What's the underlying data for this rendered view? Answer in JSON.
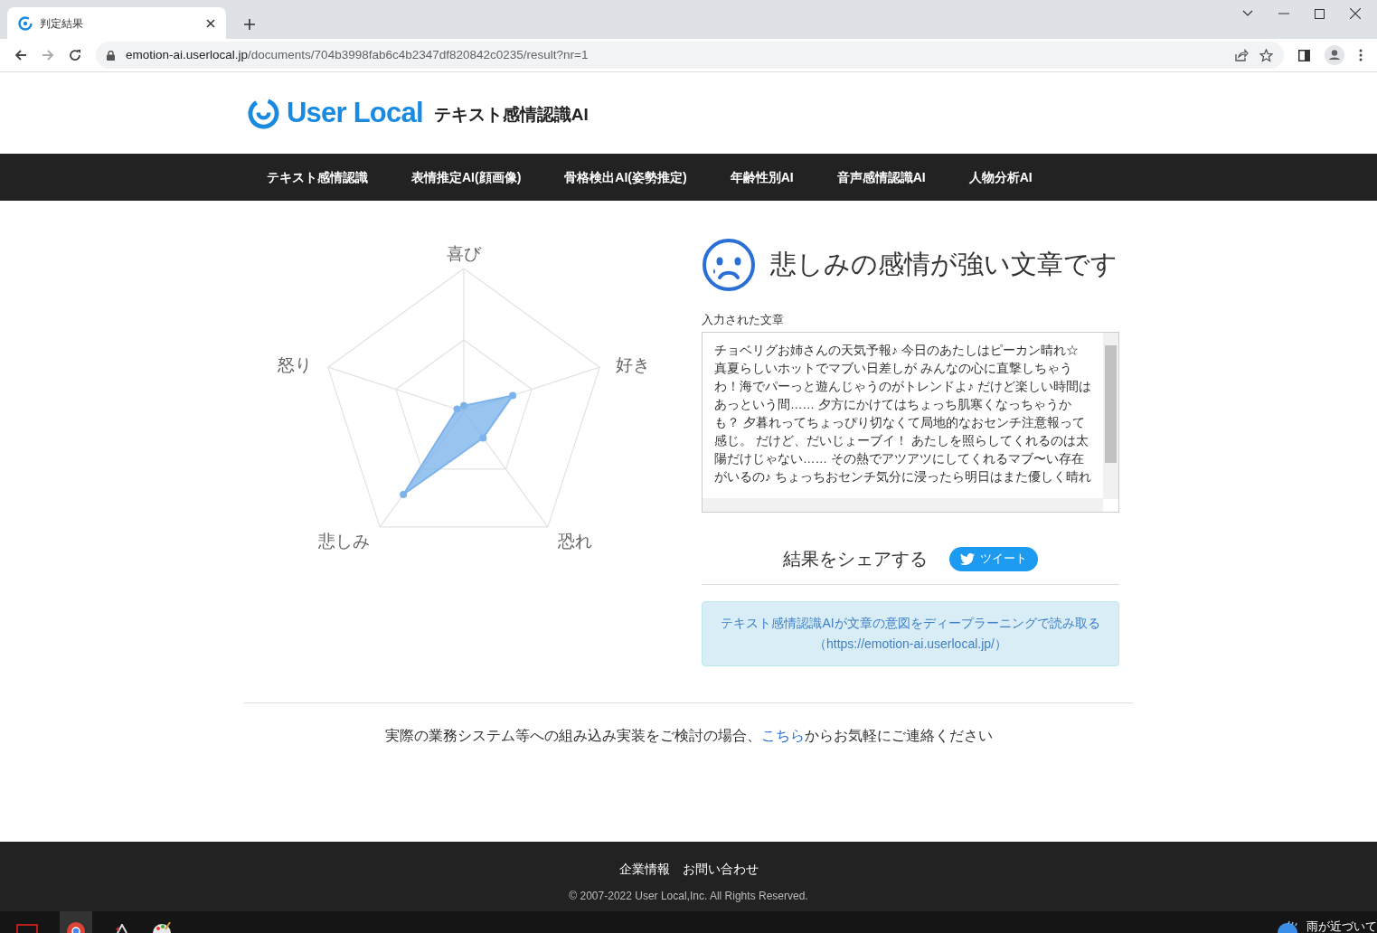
{
  "browser": {
    "tab_title": "判定結果",
    "url_host": "emotion-ai.userlocal.jp",
    "url_path": "/documents/704b3998fab6c4b2347df820842c0235/result?nr=1"
  },
  "header": {
    "logo": "User Local",
    "product": "テキスト感情認識AI"
  },
  "nav": [
    "テキスト感情認識",
    "表情推定AI(顔画像)",
    "骨格検出AI(姿勢推定)",
    "年齢性別AI",
    "音声感情認識AI",
    "人物分析AI"
  ],
  "radar": {
    "axes": [
      "喜び",
      "好き",
      "恐れ",
      "悲しみ",
      "怒り"
    ]
  },
  "result": {
    "heading": "悲しみの感情が強い文章です",
    "input_label": "入力された文章",
    "input_text": "チョベリグお姉さんの天気予報♪ 今日のあたしはピーカン晴れ☆ 真夏らしいホットでマブい日差しが みんなの心に直撃しちゃうわ！海でパーっと遊んじゃうのがトレンドよ♪ だけど楽しい時間はあっという間…… 夕方にかけてはちょっち肌寒くなっちゃうかも？ 夕暮れってちょっぴり切なくて局地的なおセンチ注意報って感じ。 だけど、だいじょーブイ！ あたしを照らしてくれるのは太陽だけじゃない…… その熱でアツアツにしてくれるマブ〜い存在がいるの♪ ちょっちおセンチ気分に浸ったら明日はまた優しく晴れ"
  },
  "share": {
    "label": "結果をシェアする",
    "button": "ツイート"
  },
  "info": {
    "line1": "テキスト感情認識AIが文章の意図をディープラーニングで読み取る",
    "line2": "（https://emotion-ai.userlocal.jp/）"
  },
  "contact": {
    "before": "実際の業務システム等への組み込み実装をご検討の場合、",
    "link": "こちら",
    "after": "からお気軽にご連絡ください"
  },
  "footer": {
    "links": [
      "企業情報",
      "お問い合わせ"
    ],
    "copyright": "© 2007-2022 User Local,Inc. All Rights Reserved."
  },
  "taskbar": {
    "weather": "雨が近づいて"
  }
}
